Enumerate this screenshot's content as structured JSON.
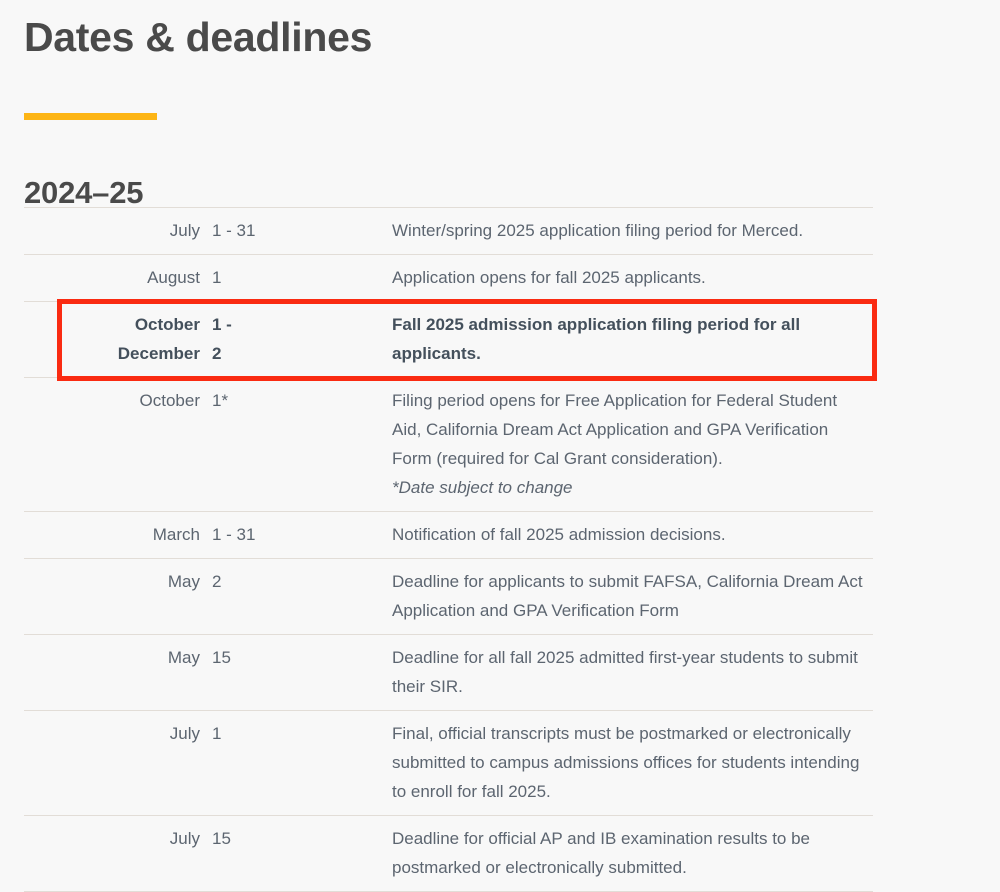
{
  "header": {
    "page_title": "Dates & deadlines",
    "accent_color": "#fdb515",
    "section_title": "2024–25"
  },
  "table": {
    "rows": [
      {
        "month": "July",
        "day": "1 - 31",
        "description": "Winter/spring 2025 application filing period for Merced.",
        "note": "",
        "highlighted": false
      },
      {
        "month": "August",
        "day": "1",
        "description": "Application opens for fall 2025 applicants.",
        "note": "",
        "highlighted": false
      },
      {
        "month": "October\nDecember",
        "day": "1 -\n2",
        "description": "Fall 2025 admission application filing period for all applicants.",
        "note": "",
        "highlighted": true
      },
      {
        "month": "October",
        "day": "1*",
        "description": "Filing period opens for Free Application for Federal Student Aid, California Dream Act Application and GPA Verification Form (required for Cal Grant consideration).",
        "note": "*Date subject to change",
        "highlighted": false
      },
      {
        "month": "March",
        "day": "1 - 31",
        "description": "Notification of fall 2025 admission decisions.",
        "note": "",
        "highlighted": false
      },
      {
        "month": "May",
        "day": "2",
        "description": "Deadline for applicants to submit FAFSA, California Dream Act Application and GPA Verification Form",
        "note": "",
        "highlighted": false
      },
      {
        "month": "May",
        "day": "15",
        "description": "Deadline for all fall 2025 admitted first-year students to submit their SIR.",
        "note": "",
        "highlighted": false
      },
      {
        "month": "July",
        "day": "1",
        "description": "Final, official transcripts must be postmarked or electronically submitted to campus admissions offices for students intending to enroll for fall 2025.",
        "note": "",
        "highlighted": false
      },
      {
        "month": "July",
        "day": "15",
        "description": "Deadline for official AP and IB examination results to be postmarked or electronically submitted.",
        "note": "",
        "highlighted": false
      }
    ]
  },
  "annotation": {
    "box_color": "#fa2b12",
    "target_row_index": 2
  }
}
